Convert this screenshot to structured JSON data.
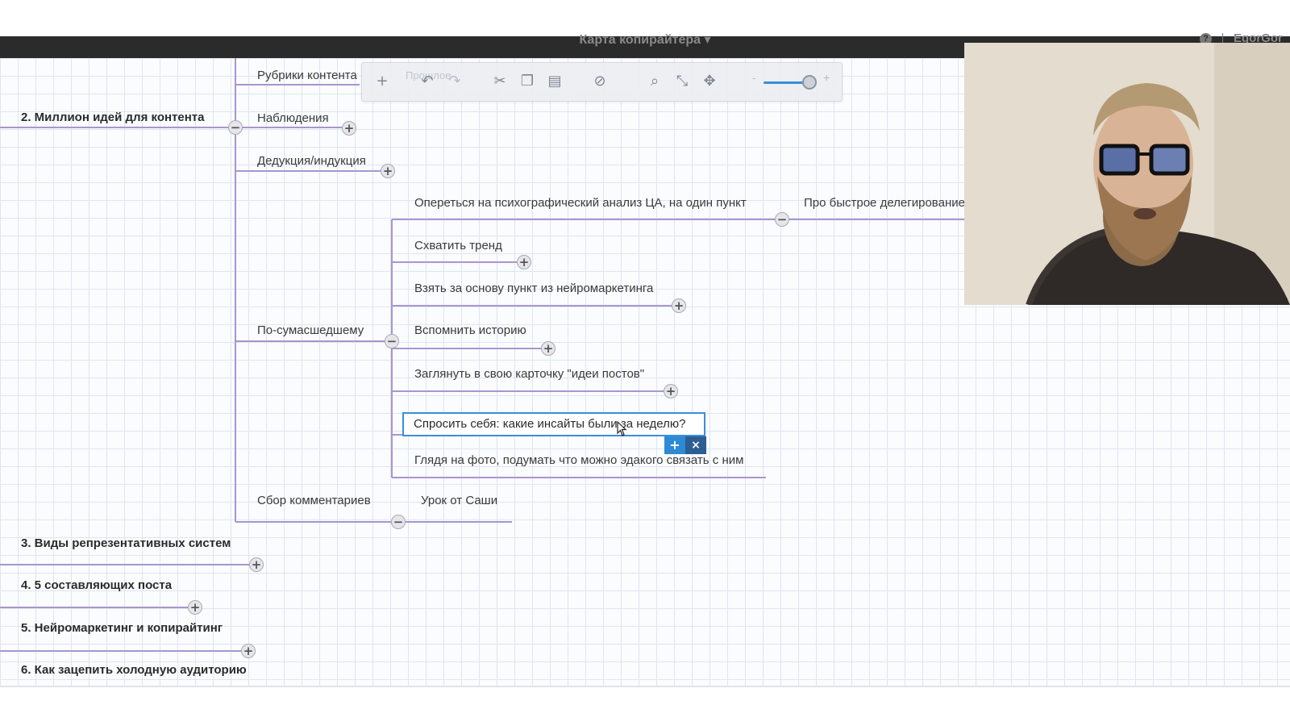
{
  "header": {
    "title": "Карта копирайтера ▾",
    "user": "EgorGor",
    "help_icon": "question-icon"
  },
  "toolbar": {
    "ghost_label": "Прошлое",
    "icons": [
      "add-icon",
      "undo-icon",
      "redo-icon",
      "cut-icon",
      "copy-icon",
      "paste-icon",
      "clear-icon",
      "search-icon",
      "collapse-icon",
      "expand-icon",
      "zoom-out-icon",
      "zoom-in-icon"
    ],
    "zoom_level": 0.85
  },
  "mindmap": {
    "main_nodes": [
      {
        "label": "2. Миллион идей для контента",
        "state": "expanded"
      },
      {
        "label": "3. Виды репрезентативных систем",
        "state": "collapsed"
      },
      {
        "label": "4. 5 составляющих поста",
        "state": "collapsed"
      },
      {
        "label": "5. Нейромаркетинг и копирайтинг",
        "state": "collapsed"
      },
      {
        "label": "6. Как зацепить холодную аудиторию",
        "state": "collapsed"
      }
    ],
    "sub_nodes": [
      {
        "label": "Рубрики контента"
      },
      {
        "label": "Наблюдения",
        "state": "collapsed"
      },
      {
        "label": "Дедукция/индукция",
        "state": "collapsed"
      },
      {
        "label": "По-сумасшедшему",
        "state": "expanded"
      },
      {
        "label": "Сбор комментариев",
        "state": "expanded"
      }
    ],
    "ideas": [
      {
        "label": "Опереться на психографический анализ ЦА, на один пункт",
        "state": "expanded"
      },
      {
        "label": "Схватить тренд",
        "state": "collapsed"
      },
      {
        "label": "Взять за основу пункт из нейромаркетинга",
        "state": "collapsed"
      },
      {
        "label": "Вспомнить историю",
        "state": "collapsed"
      },
      {
        "label": "Заглянуть в свою карточку \"идеи постов\"",
        "state": "collapsed"
      },
      {
        "label": "Спросить себя: какие инсайты были за неделю?",
        "state": "editing"
      },
      {
        "label": "Глядя на фото, подумать что можно эдакого связать с ним"
      }
    ],
    "leaf_delegation": "Про быстрое делегирование",
    "leaf_lesson": "Урок от Саши"
  },
  "edit_controls": {
    "add": "+",
    "close": "×"
  },
  "colors": {
    "line": "#a996d0",
    "accent": "#3b8ed8",
    "topbar": "#2b2b2b"
  }
}
